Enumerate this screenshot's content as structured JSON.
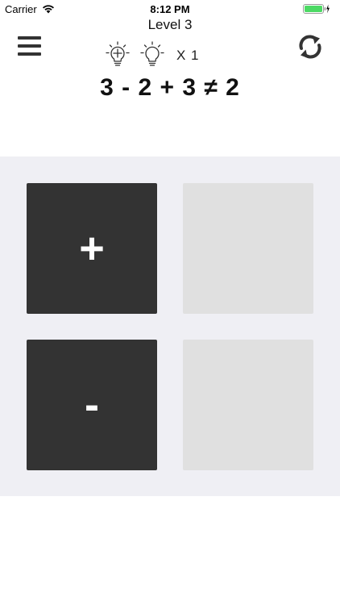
{
  "status_bar": {
    "carrier": "Carrier",
    "time": "8:12 PM",
    "wifi_icon": "wifi-icon",
    "battery_icon": "battery-charging-icon"
  },
  "header": {
    "level": "Level 3",
    "menu_icon": "hamburger-menu-icon",
    "refresh_icon": "refresh-icon",
    "hint_add_icon": "lightbulb-plus-icon",
    "hint_icon": "lightbulb-icon",
    "hint_count": "X 1"
  },
  "puzzle": {
    "equation": "3 - 2 + 3 ≠ 2"
  },
  "board": {
    "tiles": [
      {
        "symbol": "+",
        "state": "filled"
      },
      {
        "symbol": "",
        "state": "empty"
      },
      {
        "symbol": "-",
        "state": "filled"
      },
      {
        "symbol": "",
        "state": "empty"
      }
    ]
  },
  "colors": {
    "tile_dark": "#333333",
    "tile_empty": "#e0e0e0",
    "board_bg": "#efeff4",
    "battery_green": "#4cd964"
  }
}
